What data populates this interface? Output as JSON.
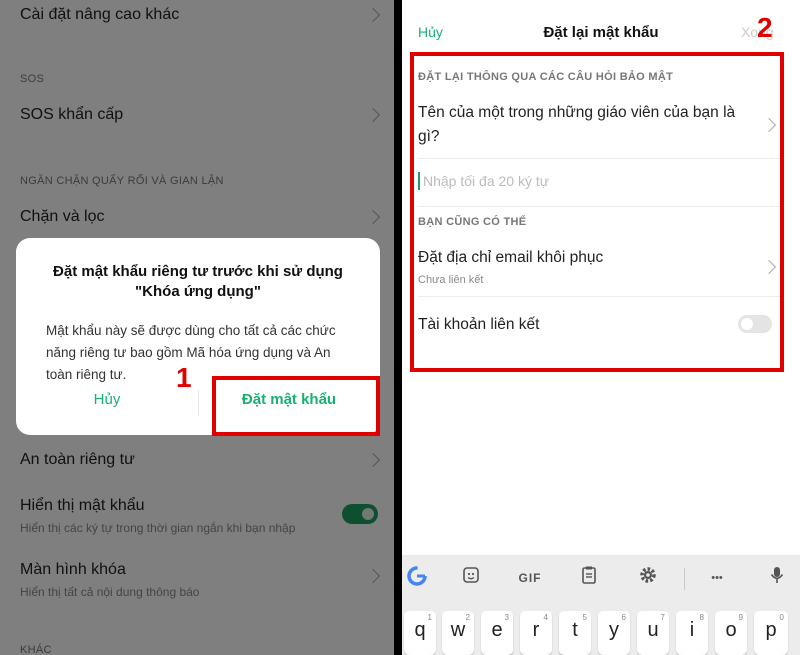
{
  "left": {
    "rows": {
      "advanced": {
        "title": "Cài đặt nâng cao khác"
      },
      "sos": {
        "title": "SOS khẩn cấp"
      },
      "block": {
        "title": "Chặn và lọc"
      },
      "privacy": {
        "title": "An toàn riêng tư"
      },
      "show_password": {
        "title": "Hiển thị mật khẩu",
        "subtitle": "Hiển thị các ký tự trong thời gian ngắn khi bạn nhập",
        "enabled": true
      },
      "lock_screen": {
        "title": "Màn hình khóa",
        "subtitle": "Hiển thị tất cả nội dung thông báo"
      }
    },
    "sections": {
      "sos": "SOS",
      "anti_fraud": "NGĂN CHẶN QUẤY RỐI VÀ GIAN LẬN",
      "other": "KHÁC"
    },
    "dialog": {
      "title": "Đặt mật khẩu riêng tư trước khi sử dụng \"Khóa ứng dụng\"",
      "body": "Mật khẩu này sẽ được dùng cho tất cả các chức năng riêng tư bao gồm Mã hóa ứng dụng và An toàn riêng tư.",
      "cancel_label": "Hủy",
      "confirm_label": "Đặt mật khẩu"
    },
    "marker": "1"
  },
  "right": {
    "header": {
      "cancel_label": "Hủy",
      "title": "Đặt lại mật khẩu",
      "done_label": "Xong"
    },
    "security_section": "ĐẶT LẠI THÔNG QUA CÁC CÂU HỎI BẢO MẬT",
    "question": "Tên của một trong những giáo viên của bạn là gì?",
    "answer_placeholder": "Nhập tối đa 20 ký tự",
    "alt_section": "BẠN CŨNG CÓ THỂ",
    "recovery_email": {
      "title": "Đặt địa chỉ email khôi phục",
      "status": "Chưa liên kết"
    },
    "linked_account": {
      "title": "Tài khoản liên kết",
      "enabled": false
    },
    "marker": "2",
    "keyboard": {
      "toolbar": [
        "google-icon",
        "sticker-icon",
        "gif-button",
        "clipboard-icon",
        "settings-icon",
        "more-icon",
        "mic-icon"
      ],
      "gif_label": "GIF",
      "more_label": "•••",
      "keys": [
        "q",
        "w",
        "e",
        "r",
        "t",
        "y",
        "u",
        "i",
        "o",
        "p"
      ],
      "key_hints": [
        "1",
        "2",
        "3",
        "4",
        "5",
        "6",
        "7",
        "8",
        "9",
        "0"
      ]
    }
  },
  "colors": {
    "accent": "#18b074",
    "highlight": "#e00000",
    "toggle_on": "#1e9e62"
  }
}
